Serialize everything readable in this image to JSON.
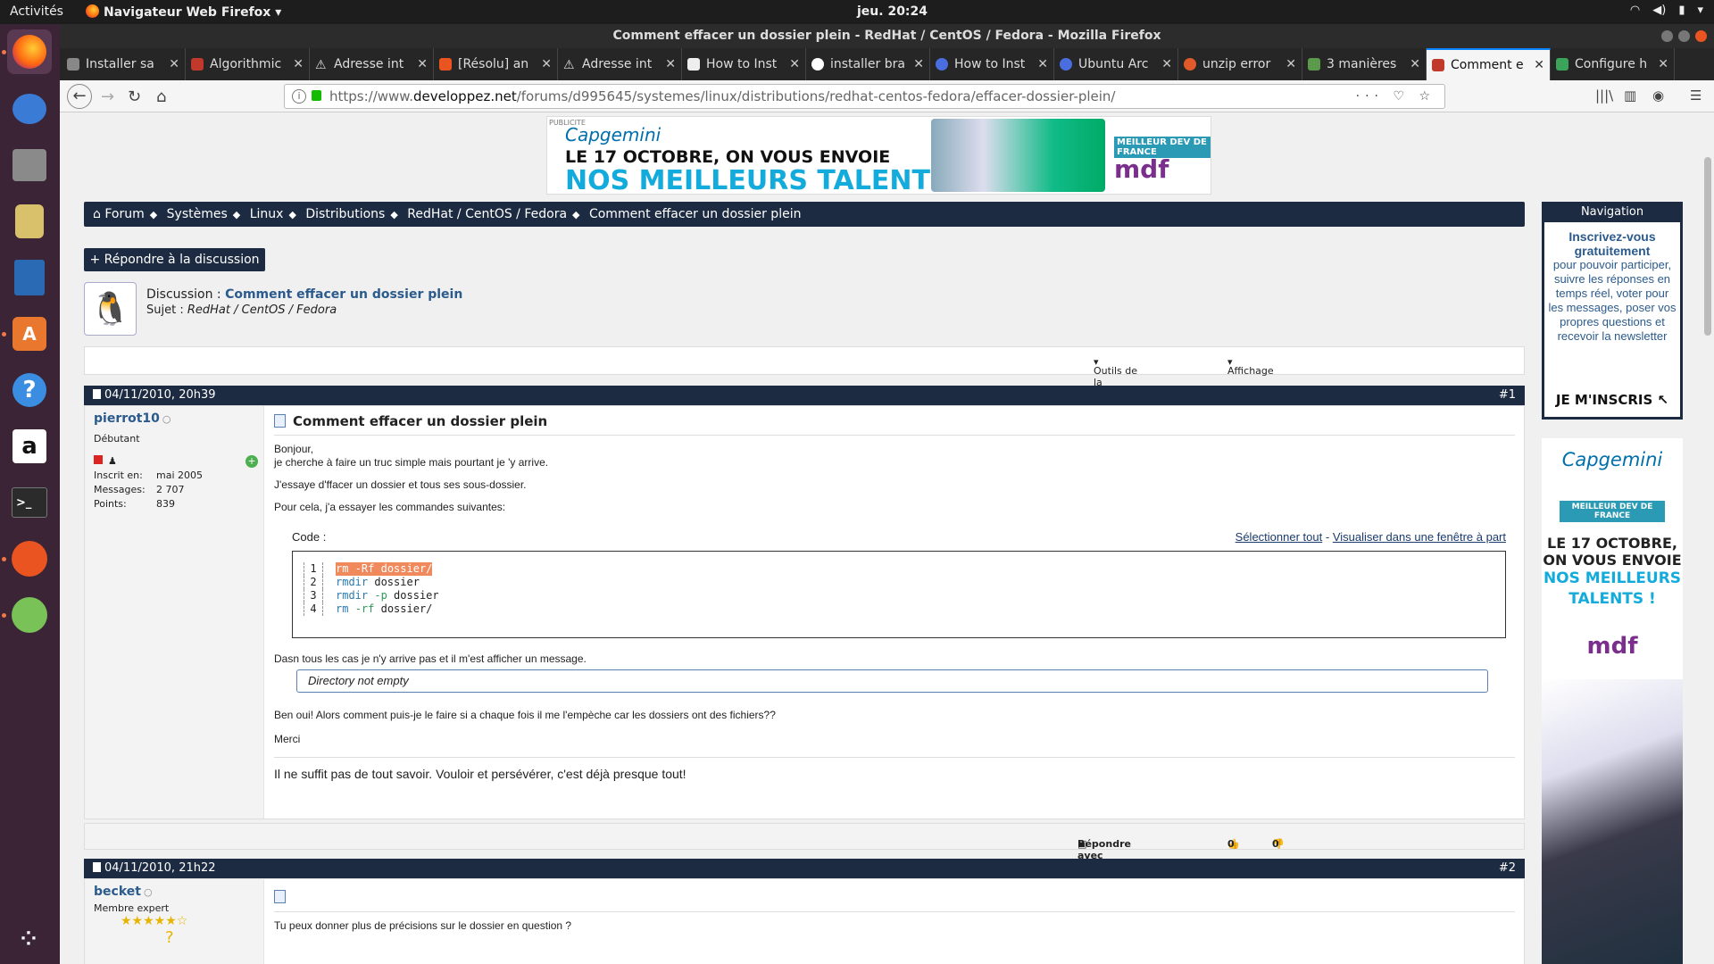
{
  "system": {
    "activities": "Activités",
    "app_name": "Navigateur Web Firefox",
    "clock": "jeu. 20:24"
  },
  "window": {
    "title": "Comment effacer un dossier plein - RedHat / CentOS / Fedora - Mozilla Firefox"
  },
  "tabs": [
    {
      "label": "Installer sa"
    },
    {
      "label": "Algorithmic"
    },
    {
      "label": "Adresse int"
    },
    {
      "label": "[Résolu] an"
    },
    {
      "label": "Adresse int"
    },
    {
      "label": "How to Inst"
    },
    {
      "label": "installer bra"
    },
    {
      "label": "How to Inst"
    },
    {
      "label": "Ubuntu Arc"
    },
    {
      "label": "unzip error"
    },
    {
      "label": "3 manières"
    },
    {
      "label": "Comment e"
    },
    {
      "label": "Configure h"
    }
  ],
  "url": {
    "prefix": "https://www.",
    "domain": "developpez.net",
    "path": "/forums/d995645/systemes/linux/distributions/redhat-centos-fedora/effacer-dossier-plein/"
  },
  "banner": {
    "brand": "Capgemini",
    "line1": "LE 17 OCTOBRE, ON VOUS ENVOIE",
    "line2": "NOS MEILLEURS TALENTS !",
    "badge": "MEILLEUR DEV DE FRANCE",
    "mdf": "mdf",
    "pub": "PUBLICITE"
  },
  "breadcrumb": {
    "items": [
      "Forum",
      "Systèmes",
      "Linux",
      "Distributions",
      "RedHat / CentOS / Fedora",
      "Comment effacer un dossier plein"
    ]
  },
  "reply_button": "+ Répondre à la discussion",
  "thread": {
    "discussion_label": "Discussion :",
    "discussion_title": "Comment effacer un dossier plein",
    "subject_label": "Sujet :",
    "subject": "RedHat / CentOS / Fedora"
  },
  "tools": {
    "thread_tools": "Outils de la discussion",
    "display": "Affichage"
  },
  "posts": [
    {
      "date": "04/11/2010, 20h39",
      "num": "#1",
      "user": "pierrot10",
      "rank": "Débutant",
      "joined_label": "Inscrit en:",
      "joined": "mai 2005",
      "messages_label": "Messages:",
      "messages": "2 707",
      "points_label": "Points:",
      "points": "839",
      "title": "Comment effacer un dossier plein",
      "p1": "Bonjour,",
      "p2": "je cherche à faire un truc simple mais pourtant je 'y arrive.",
      "p3": "J'essaye d'ffacer un dossier et tous ses sous-dossier.",
      "p4": "Pour cela, j'a essayer les commandes suivantes:",
      "code_label": "Code :",
      "select_all": "Sélectionner tout",
      "link_sep": "-",
      "view_window": "Visualiser dans une fenêtre à part",
      "code": [
        {
          "n": "1",
          "cmd": "rm",
          "opt": "-Rf",
          "arg": "dossier/"
        },
        {
          "n": "2",
          "cmd": "rmdir",
          "opt": "",
          "arg": "dossier"
        },
        {
          "n": "3",
          "cmd": "rmdir",
          "opt": "-p",
          "arg": "dossier"
        },
        {
          "n": "4",
          "cmd": "rm",
          "opt": "-rf",
          "arg": "dossier/"
        }
      ],
      "p5": "Dasn tous les cas je n'y arrive pas et il m'est afficher un message.",
      "quote": "Directory not empty",
      "p6": "Ben oui! Alors comment puis-je le faire si a chaque fois il me l'empèche car les dossiers ont des fichiers??",
      "p7": "Merci",
      "signature": "Il ne suffit pas de tout savoir. Vouloir et persévérer, c'est déjà presque tout!",
      "reply_quote": "Répondre avec citation",
      "likes": "0",
      "dislikes": "0"
    },
    {
      "date": "04/11/2010, 21h22",
      "num": "#2",
      "user": "becket",
      "rank": "Membre expert",
      "body": "Tu peux donner plus de précisions sur le dossier en question ?"
    }
  ],
  "navigation": {
    "title": "Navigation",
    "bold": "Inscrivez-vous gratuitement",
    "text": "pour pouvoir participer, suivre les réponses en temps réel, voter pour les messages, poser vos propres questions et recevoir la newsletter",
    "cta": "JE M'INSCRIS"
  },
  "side_ad": {
    "brand": "Capgemini",
    "badge": "MEILLEUR DEV DE FRANCE",
    "line1": "LE 17 OCTOBRE,",
    "line2": "ON VOUS ENVOIE",
    "line3": "NOS MEILLEURS",
    "line4": "TALENTS !",
    "mdf": "mdf"
  }
}
